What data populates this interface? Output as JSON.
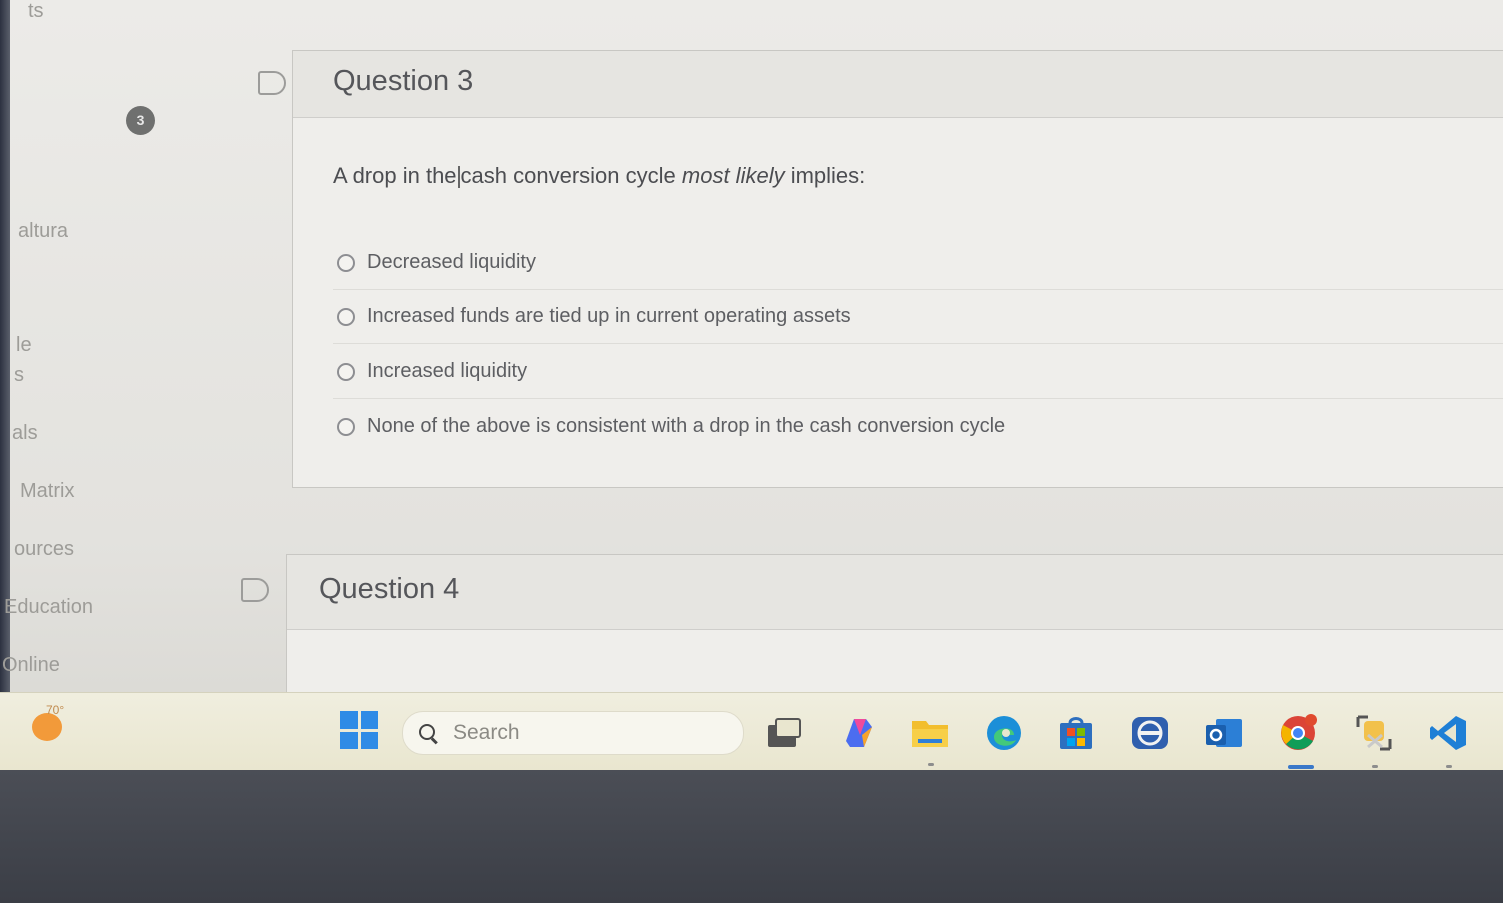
{
  "nav": {
    "items": [
      "ts",
      "altura",
      "le",
      "s",
      "als",
      "Matrix",
      "ources",
      "Education",
      "Online"
    ],
    "badge": "3"
  },
  "question3": {
    "title": "Question 3",
    "prompt_before": "A drop in the",
    "prompt_after_cursor": "cash conversion cycle",
    "prompt_emphasis": "most likely",
    "prompt_end": "implies:",
    "options": [
      "Decreased liquidity",
      "Increased funds are tied up in current operating assets",
      "Increased liquidity",
      "None of the above is consistent with a drop in the cash conversion cycle"
    ]
  },
  "question4": {
    "title": "Question 4"
  },
  "taskbar": {
    "weather_temp": "70°",
    "search_placeholder": "Search",
    "apps": [
      "task-view-icon",
      "copilot-icon",
      "file-explorer-icon",
      "edge-icon",
      "store-icon",
      "teams-icon",
      "outlook-icon",
      "chrome-icon",
      "snipping-tool-icon",
      "vscode-icon"
    ]
  },
  "colors": {
    "accent": "#3a78c9",
    "windows_blue": "#2f8be6"
  }
}
